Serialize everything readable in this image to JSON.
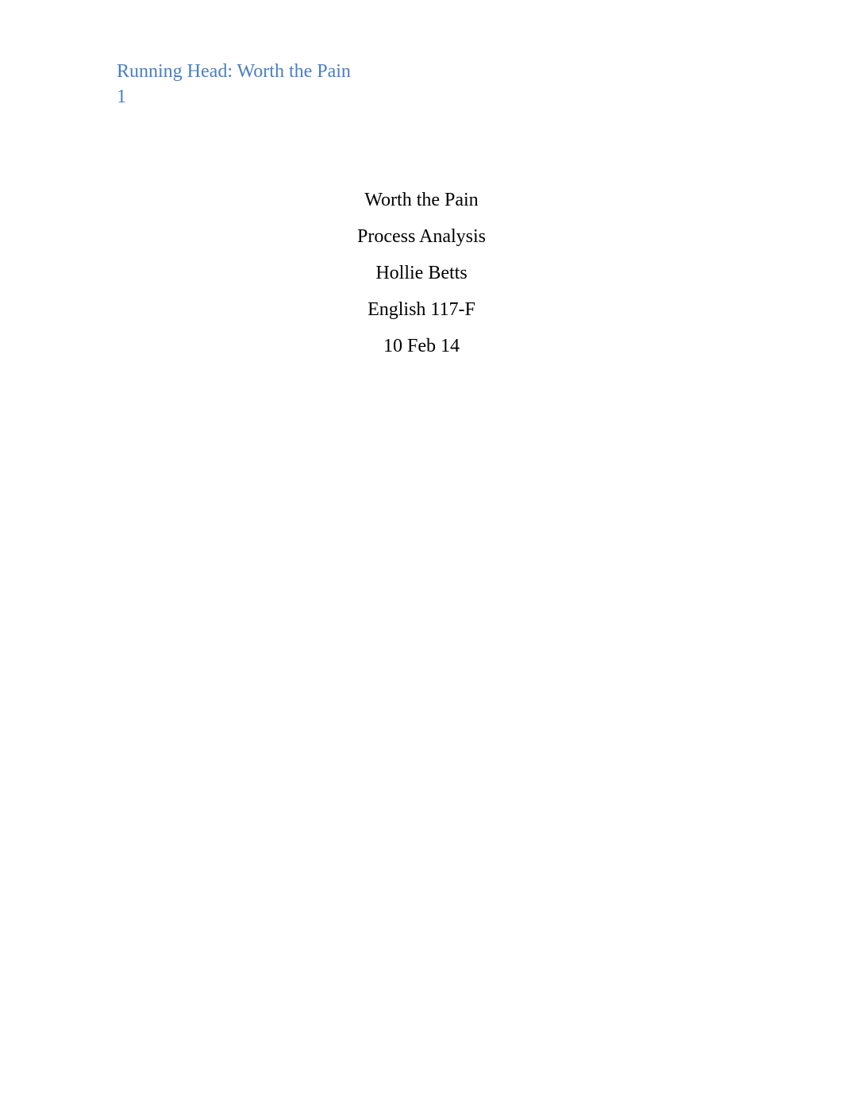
{
  "header": {
    "running_head": "Running Head: Worth the Pain",
    "page_number": "1"
  },
  "title_block": {
    "title": "Worth the Pain",
    "subtitle": "Process Analysis",
    "author": "Hollie Betts",
    "course": "English 117-F",
    "date": "10 Feb 14"
  }
}
